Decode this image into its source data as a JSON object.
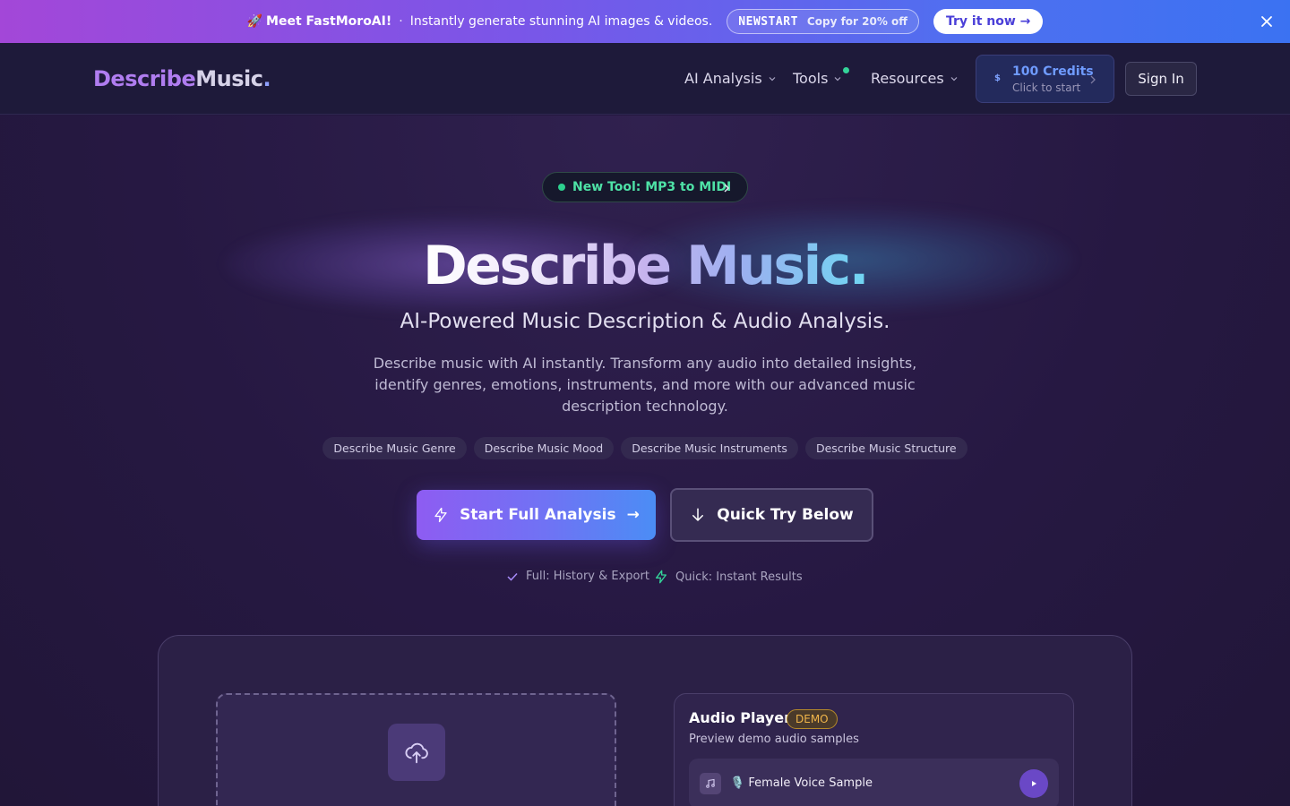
{
  "promo": {
    "rocket": "🚀",
    "brand": "Meet FastMoroAI!",
    "separator": "·",
    "text": "Instantly generate stunning AI images & videos.",
    "code": "NEWSTART",
    "code_hint": "Copy for 20% off",
    "cta": "Try it now →"
  },
  "nav": {
    "logo_part1": "Describe",
    "logo_part2": "Music",
    "logo_part3": ".",
    "items": [
      {
        "label": "AI Analysis"
      },
      {
        "label": "Tools"
      },
      {
        "label": "Resources"
      }
    ],
    "credits_coin": "$",
    "credits_title": "100 Credits",
    "credits_sub": "Click to start",
    "signin": "Sign In"
  },
  "hero": {
    "badge": "New Tool: MP3 to MIDI",
    "title": "Describe Music.",
    "subtitle": "AI-Powered Music Description & Audio Analysis.",
    "description": "Describe music with AI instantly. Transform any audio into detailed insights, identify genres, emotions, instruments, and more with our advanced music description technology.",
    "chips": [
      "Describe Music Genre",
      "Describe Music Mood",
      "Describe Music Instruments",
      "Describe Music Structure"
    ],
    "primary_cta": "Start Full Analysis",
    "primary_arrow": "→",
    "secondary_cta": "Quick Try Below",
    "feature_full": "Full: History & Export",
    "feature_quick": "Quick: Instant Results"
  },
  "player": {
    "title": "Audio Player",
    "badge": "DEMO",
    "subtitle": "Preview demo audio samples",
    "track_emoji": "🎙️",
    "track_label": "Female Voice Sample"
  },
  "colors": {
    "accent_purple": "#8e5cf2",
    "accent_blue": "#4b8df5",
    "success_green": "#34d399",
    "demo_amber": "#f2b64a"
  },
  "icons": [
    "rocket-icon",
    "close-icon",
    "chevron-down-icon",
    "chevron-right-icon",
    "bolt-icon",
    "arrow-down-icon",
    "check-icon",
    "cloud-upload-icon",
    "music-note-icon",
    "microphone-icon",
    "play-icon"
  ]
}
